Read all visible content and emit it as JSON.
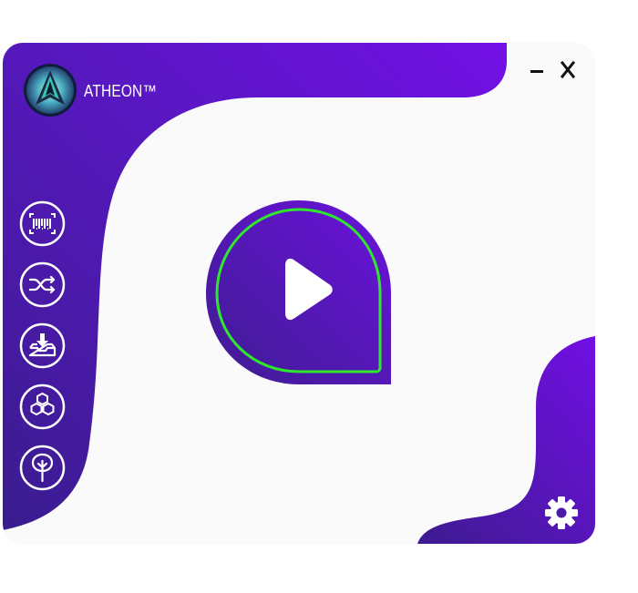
{
  "app": {
    "title": "ATHEON™"
  },
  "window_controls": {
    "minimize_icon": "minimize-icon",
    "close_icon": "close-icon"
  },
  "sidebar": {
    "items": [
      {
        "name": "scan",
        "icon": "barcode-scan-icon"
      },
      {
        "name": "shuffle",
        "icon": "shuffle-icon"
      },
      {
        "name": "download",
        "icon": "inbox-download-icon"
      },
      {
        "name": "hexagons",
        "icon": "hexagon-cluster-icon"
      },
      {
        "name": "tree",
        "icon": "tree-icon"
      }
    ]
  },
  "main": {
    "play_icon": "play-icon"
  },
  "footer": {
    "settings_icon": "gear-icon"
  },
  "colors": {
    "accent_purple": "#6a14d9",
    "deep_purple": "#3d1a8c",
    "ring_green": "#2ee82e",
    "surface": "#fafafa"
  }
}
